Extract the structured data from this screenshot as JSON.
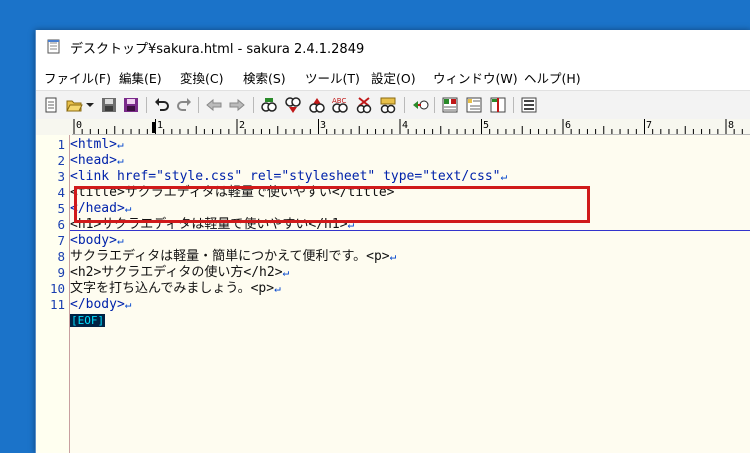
{
  "window": {
    "title": "デスクトップ¥sakura.html - sakura 2.4.1.2849"
  },
  "menu": [
    "ファイル(F)",
    "編集(E)",
    "変換(C)",
    "検索(S)",
    "ツール(T)",
    "設定(O)",
    "ウィンドウ(W)",
    "ヘルプ(H)"
  ],
  "ruler": {
    "labels": [
      "0",
      "1",
      "2",
      "3",
      "4",
      "5",
      "6",
      "7",
      "8"
    ]
  },
  "editor": {
    "line_numbers": [
      "1",
      "2",
      "3",
      "4",
      "5",
      "6",
      "7",
      "8",
      "9",
      "10",
      "11"
    ],
    "lines": [
      "<html>",
      "<head>",
      "<link href=\"style.css\" rel=\"stylesheet\" type=\"text/css\"",
      "<title>サクラエディタは軽量で使いやすい</title>",
      "</head>",
      "<h1>サクラエディタは軽量で使いやすい</h1>",
      "<body>",
      "サクラエディタは軽量・簡単につかえて便利です。<p>",
      "<h2>サクラエディタの使い方</h2>",
      "文字を打ち込んでみましょう。<p>",
      "</body>"
    ],
    "return_mark": "↵",
    "eof_label": "[EOF]"
  },
  "colors": {
    "desktop": "#1b73c9",
    "highlight_box": "#d01a1a",
    "line_number": "#1a3fb0",
    "tag": "#0022aa",
    "eof_bg": "#002244",
    "eof_fg": "#00e0ff"
  }
}
